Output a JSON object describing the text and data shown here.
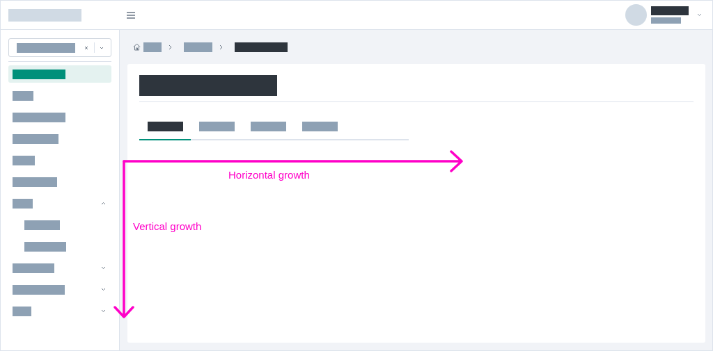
{
  "sidebar": {
    "items": [
      {
        "selected": true
      },
      {
        "selected": false
      },
      {
        "selected": false
      },
      {
        "selected": false
      },
      {
        "selected": false
      },
      {
        "selected": false
      },
      {
        "selected": false,
        "expanded": true,
        "children": [
          {
            "selected": false
          },
          {
            "selected": false
          }
        ]
      },
      {
        "selected": false,
        "expanded": false
      },
      {
        "selected": false,
        "expanded": false
      },
      {
        "selected": false,
        "expanded": false
      }
    ]
  },
  "tabs": [
    {
      "selected": true
    },
    {
      "selected": false
    },
    {
      "selected": false
    },
    {
      "selected": false
    }
  ],
  "annotations": [
    {
      "kind": "horizontal",
      "label": "Horizontal growth"
    },
    {
      "kind": "vertical",
      "label": "Vertical growth"
    }
  ]
}
